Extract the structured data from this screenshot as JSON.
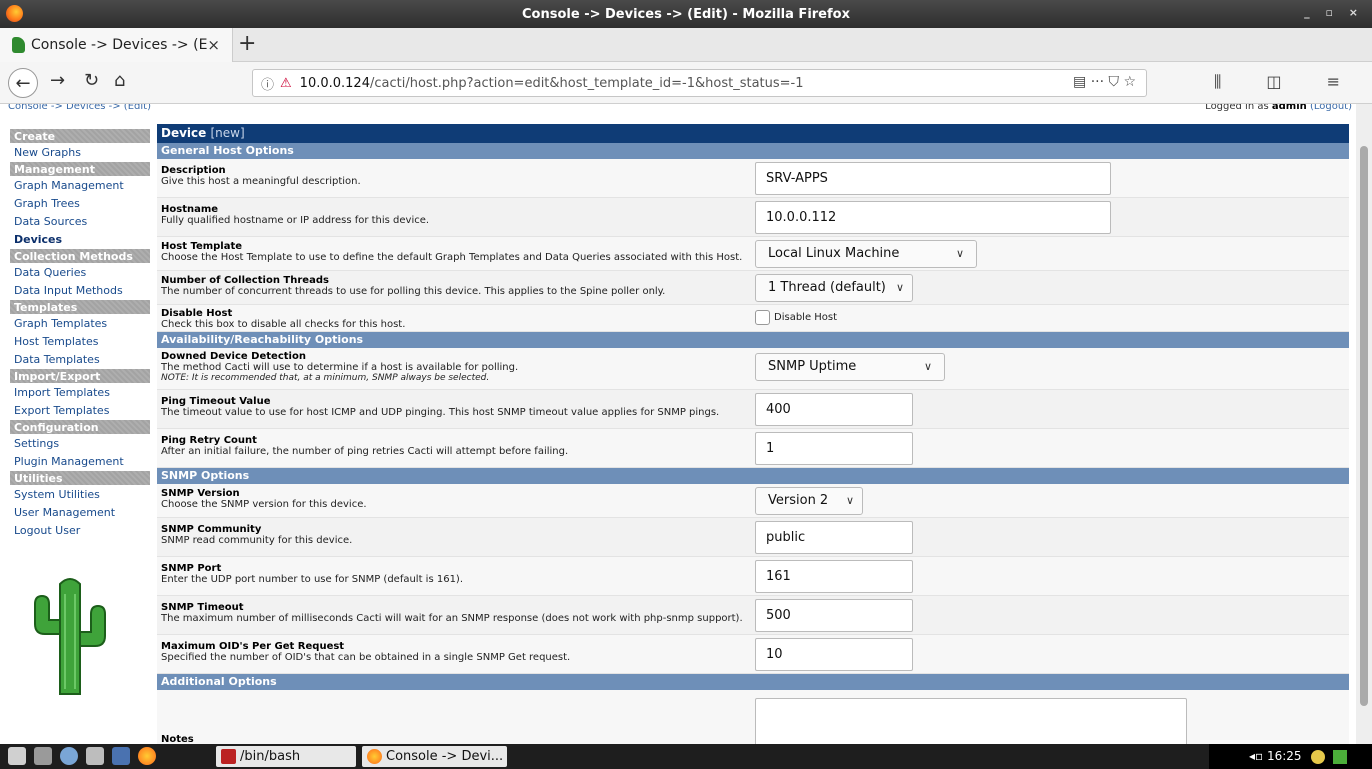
{
  "window": {
    "title": "Console -> Devices -> (Edit) - Mozilla Firefox",
    "controls": "_ ▫ ×"
  },
  "tab": {
    "label": "Console -> Devices -> (E",
    "close": "×",
    "new": "+"
  },
  "nav": {
    "url_host": "10.0.0.124",
    "url_path": "/cacti/host.php?action=edit&host_template_id=-1&host_status=-1",
    "right_icons": "▤   ···  ⛉  ☆",
    "menu_icons": "⫼ ◫ ≡"
  },
  "page": {
    "breadcrumb": "Console -> Devices -> (Edit)",
    "logged_in_prefix": "Logged in as",
    "user": "admin",
    "logout": "(Logout)"
  },
  "sidebar": [
    {
      "type": "header",
      "label": "Create"
    },
    {
      "type": "item",
      "label": "New Graphs"
    },
    {
      "type": "header",
      "label": "Management"
    },
    {
      "type": "item",
      "label": "Graph Management"
    },
    {
      "type": "item",
      "label": "Graph Trees"
    },
    {
      "type": "item",
      "label": "Data Sources"
    },
    {
      "type": "item",
      "label": "Devices",
      "active": true
    },
    {
      "type": "header",
      "label": "Collection Methods"
    },
    {
      "type": "item",
      "label": "Data Queries"
    },
    {
      "type": "item",
      "label": "Data Input Methods"
    },
    {
      "type": "header",
      "label": "Templates"
    },
    {
      "type": "item",
      "label": "Graph Templates"
    },
    {
      "type": "item",
      "label": "Host Templates"
    },
    {
      "type": "item",
      "label": "Data Templates"
    },
    {
      "type": "header",
      "label": "Import/Export"
    },
    {
      "type": "item",
      "label": "Import Templates"
    },
    {
      "type": "item",
      "label": "Export Templates"
    },
    {
      "type": "header",
      "label": "Configuration"
    },
    {
      "type": "item",
      "label": "Settings"
    },
    {
      "type": "item",
      "label": "Plugin Management"
    },
    {
      "type": "header",
      "label": "Utilities"
    },
    {
      "type": "item",
      "label": "System Utilities"
    },
    {
      "type": "item",
      "label": "User Management"
    },
    {
      "type": "item",
      "label": "Logout User"
    }
  ],
  "form": {
    "title": "Device",
    "title_suffix": "[new]",
    "sections": {
      "general": "General Host Options",
      "availability": "Availability/Reachability Options",
      "snmp": "SNMP Options",
      "additional": "Additional Options"
    },
    "description": {
      "label": "Description",
      "help": "Give this host a meaningful description.",
      "value": "SRV-APPS"
    },
    "hostname": {
      "label": "Hostname",
      "help": "Fully qualified hostname or IP address for this device.",
      "value": "10.0.0.112"
    },
    "host_template": {
      "label": "Host Template",
      "help": "Choose the Host Template to use to define the default Graph Templates and Data Queries associated with this Host.",
      "value": "Local Linux Machine"
    },
    "threads": {
      "label": "Number of Collection Threads",
      "help": "The number of concurrent threads to use for polling this device. This applies to the Spine poller only.",
      "value": "1 Thread (default)"
    },
    "disable": {
      "label": "Disable Host",
      "help": "Check this box to disable all checks for this host.",
      "checkbox_label": "Disable Host"
    },
    "downed": {
      "label": "Downed Device Detection",
      "help": "The method Cacti will use to determine if a host is available for polling.",
      "note": "NOTE: It is recommended that, at a minimum, SNMP always be selected.",
      "value": "SNMP Uptime"
    },
    "ping_timeout": {
      "label": "Ping Timeout Value",
      "help": "The timeout value to use for host ICMP and UDP pinging. This host SNMP timeout value applies for SNMP pings.",
      "value": "400"
    },
    "ping_retry": {
      "label": "Ping Retry Count",
      "help": "After an initial failure, the number of ping retries Cacti will attempt before failing.",
      "value": "1"
    },
    "snmp_version": {
      "label": "SNMP Version",
      "help": "Choose the SNMP version for this device.",
      "value": "Version 2"
    },
    "snmp_community": {
      "label": "SNMP Community",
      "help": "SNMP read community for this device.",
      "value": "public"
    },
    "snmp_port": {
      "label": "SNMP Port",
      "help": "Enter the UDP port number to use for SNMP (default is 161).",
      "value": "161"
    },
    "snmp_timeout": {
      "label": "SNMP Timeout",
      "help": "The maximum number of milliseconds Cacti will wait for an SNMP response (does not work with php-snmp support).",
      "value": "500"
    },
    "max_oids": {
      "label": "Maximum OID's Per Get Request",
      "help": "Specified the number of OID's that can be obtained in a single SNMP Get request.",
      "value": "10"
    },
    "notes": {
      "label": "Notes"
    }
  },
  "taskbar": {
    "tasks": [
      "/bin/bash",
      "Console -> Devi..."
    ],
    "time": "16:25"
  }
}
